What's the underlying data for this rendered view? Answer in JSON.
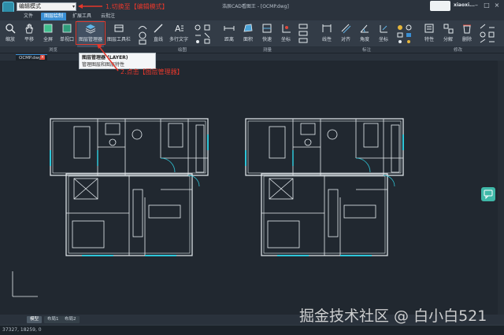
{
  "titlebar": {
    "mode_value": "编辑模式",
    "title": "浩辰CAD看图王 - [OCMP.dwg]",
    "user": "xiaoxi..."
  },
  "menu": {
    "items": [
      "文件",
      "图层绘制",
      "扩展工具",
      "云批注"
    ],
    "active_index": 1
  },
  "ribbon": {
    "tools": [
      {
        "label": "缩放",
        "icon": "zoom-icon"
      },
      {
        "label": "平移",
        "icon": "pan-hand-icon"
      },
      {
        "label": "全屏",
        "icon": "fullscreen-icon"
      },
      {
        "label": "单视口",
        "icon": "viewport-icon"
      },
      {
        "label": "图层管理器",
        "icon": "layers-icon"
      },
      {
        "label": "图层工具栏",
        "icon": "layer-toolbar-icon"
      },
      {
        "label": "直线",
        "icon": "line-icon"
      },
      {
        "label": "多行文字",
        "icon": "mtext-icon"
      },
      {
        "label": "距离",
        "icon": "distance-icon"
      },
      {
        "label": "面积",
        "icon": "area-icon"
      },
      {
        "label": "快速",
        "icon": "quick-measure-icon"
      },
      {
        "label": "坐标",
        "icon": "coordinate-icon"
      },
      {
        "label": "线性",
        "icon": "linear-dim-icon"
      },
      {
        "label": "对齐",
        "icon": "aligned-dim-icon"
      },
      {
        "label": "角度",
        "icon": "angle-dim-icon"
      },
      {
        "label": "坐标",
        "icon": "ordinate-dim-icon"
      },
      {
        "label": "特性",
        "icon": "properties-icon"
      },
      {
        "label": "分解",
        "icon": "explode-icon"
      },
      {
        "label": "删除",
        "icon": "delete-icon"
      }
    ],
    "groups": [
      "浏览",
      "绘图",
      "测量",
      "标注",
      "修改"
    ]
  },
  "document": {
    "tab_label": "OCMP.dwg",
    "layout_tabs": [
      "模型",
      "布局1",
      "布局2"
    ],
    "active_layout": 0
  },
  "tooltip": {
    "title": "图层管理器 (LAYER)",
    "description": "管理图层和图层特性"
  },
  "annotations": {
    "step1": "1.切换至【编辑模式】",
    "step2": "2.点击【图层管理器】"
  },
  "status": {
    "coords": "37327, 18259, 0"
  },
  "watermark": "掘金技术社区 @ 白小白521",
  "colors": {
    "accent": "#3a8fd4",
    "annotation_red": "#e5372b",
    "cad_wall": "#e8eef2",
    "cad_cyan": "#2fc7d9"
  }
}
